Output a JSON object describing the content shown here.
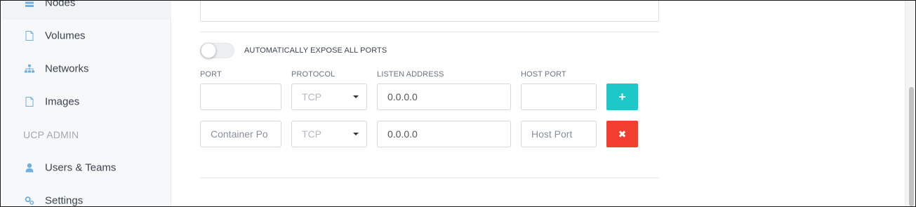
{
  "sidebar": {
    "items": [
      {
        "label": "Nodes",
        "icon": "nodes-icon"
      },
      {
        "label": "Volumes",
        "icon": "file-icon"
      },
      {
        "label": "Networks",
        "icon": "network-icon"
      },
      {
        "label": "Images",
        "icon": "file-icon"
      }
    ],
    "section_header": "UCP ADMIN",
    "admin_items": [
      {
        "label": "Users & Teams",
        "icon": "user-icon"
      },
      {
        "label": "Settings",
        "icon": "gears-icon"
      }
    ],
    "icon_color": "#6fb0e0"
  },
  "ports": {
    "toggle_label": "AUTOMATICALLY EXPOSE ALL PORTS",
    "toggle_on": false,
    "columns": {
      "port": "PORT",
      "protocol": "PROTOCOL",
      "listen_address": "LISTEN ADDRESS",
      "host_port": "HOST PORT"
    },
    "rows": [
      {
        "port_value": "",
        "port_placeholder": "",
        "protocol": "TCP",
        "listen_address": "0.0.0.0",
        "host_port_value": "",
        "host_port_placeholder": "",
        "action": "+"
      },
      {
        "port_value": "",
        "port_placeholder": "Container Po",
        "protocol": "TCP",
        "listen_address": "0.0.0.0",
        "host_port_value": "",
        "host_port_placeholder": "Host Port",
        "action": "✖"
      }
    ]
  },
  "colors": {
    "add_button": "#1ec8c8",
    "remove_button": "#f23e2e"
  }
}
